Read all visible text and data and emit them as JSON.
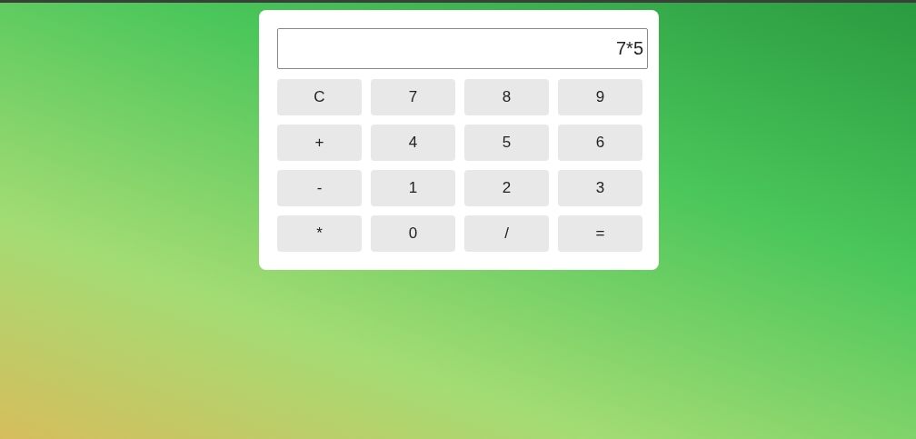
{
  "display": {
    "value": "7*5"
  },
  "keys": [
    "C",
    "7",
    "8",
    "9",
    "+",
    "4",
    "5",
    "6",
    "-",
    "1",
    "2",
    "3",
    "*",
    "0",
    "/",
    "="
  ]
}
